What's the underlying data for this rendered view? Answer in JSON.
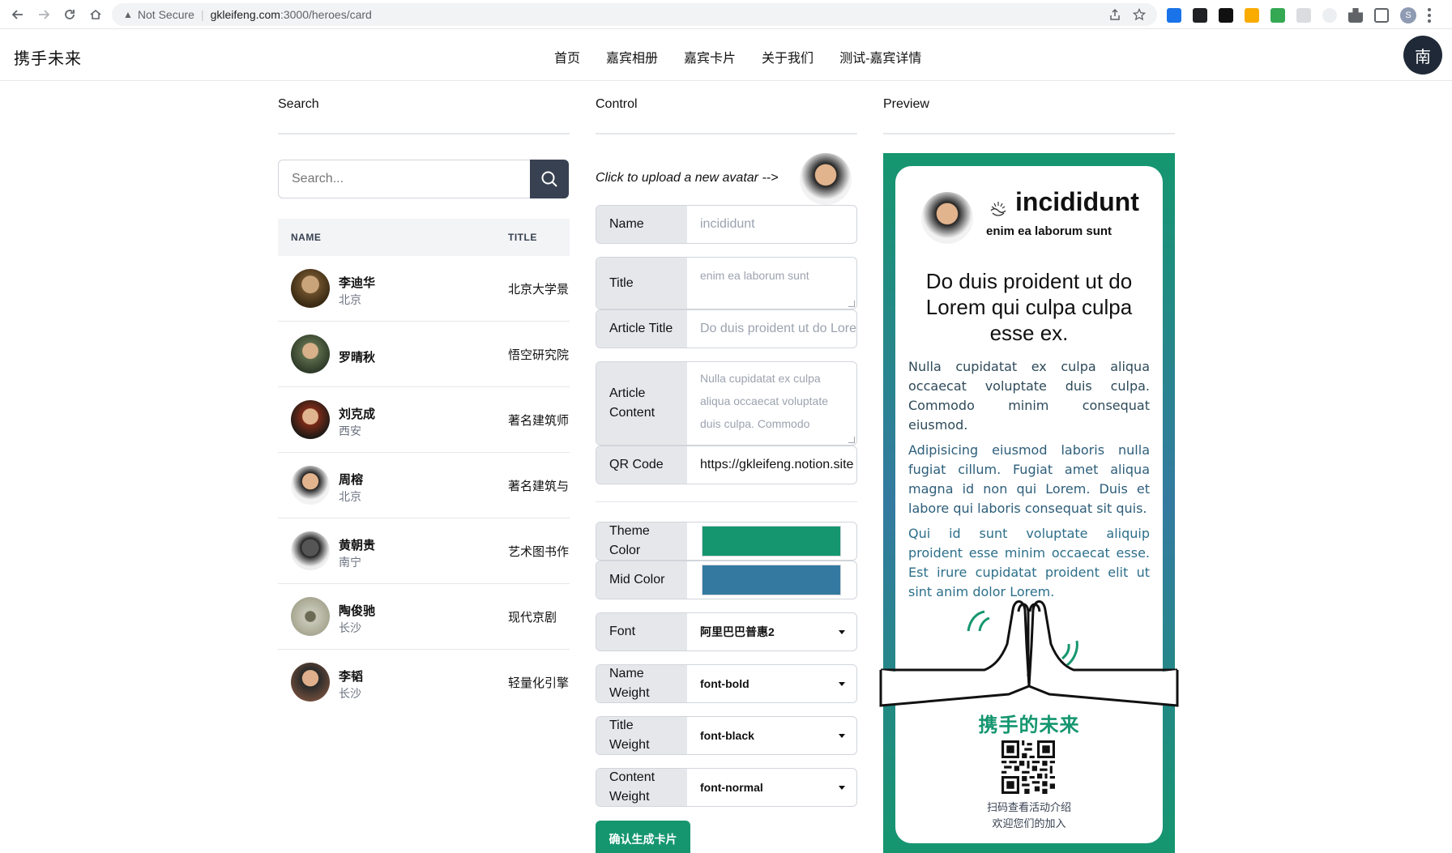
{
  "browser": {
    "security_label": "Not Secure",
    "url_host": "gkleifeng.com",
    "url_path": ":3000/heroes/card",
    "profile_initial": "S"
  },
  "site": {
    "brand": "携手未来",
    "nav": [
      "首页",
      "嘉宾相册",
      "嘉宾卡片",
      "关于我们",
      "测试-嘉宾详情"
    ],
    "user_avatar_char": "南"
  },
  "search": {
    "title": "Search",
    "placeholder": "Search...",
    "col_name": "NAME",
    "col_title": "TITLE",
    "rows": [
      {
        "name": "李迪华",
        "city": "北京",
        "title": "北京大学景"
      },
      {
        "name": "罗晴秋",
        "city": "",
        "title": "悟空研究院"
      },
      {
        "name": "刘克成",
        "city": "西安",
        "title": "著名建筑师"
      },
      {
        "name": "周榕",
        "city": "北京",
        "title": "著名建筑与"
      },
      {
        "name": "黄朝贵",
        "city": "南宁",
        "title": "艺术图书作"
      },
      {
        "name": "陶俊驰",
        "city": "长沙",
        "title": "现代京剧"
      },
      {
        "name": "李韬",
        "city": "长沙",
        "title": "轻量化引擎"
      }
    ]
  },
  "control": {
    "title": "Control",
    "upload_label": "Click to upload a new avatar -->",
    "fields": {
      "name_label": "Name",
      "name_value": "incididunt",
      "title_label": "Title",
      "title_value": "enim ea laborum sunt",
      "article_title_label": "Article Title",
      "article_title_value": "Do duis proident ut do Lorem qui culpa culpa esse ex.",
      "article_content_label": "Article Content",
      "article_content_value": "Nulla cupidatat ex culpa aliqua occaecat voluptate duis culpa. Commodo",
      "qr_label": "QR Code",
      "qr_value": "https://gkleifeng.notion.site",
      "theme_color_label": "Theme Color",
      "mid_color_label": "Mid Color",
      "font_label": "Font",
      "font_value": "阿里巴巴普惠2",
      "name_weight_label": "Name Weight",
      "name_weight_value": "font-bold",
      "title_weight_label": "Title Weight",
      "title_weight_value": "font-black",
      "content_weight_label": "Content Weight",
      "content_weight_value": "font-normal"
    },
    "theme_color": "#15966f",
    "mid_color": "#347aa0",
    "submit_label": "确认生成卡片"
  },
  "preview": {
    "title": "Preview",
    "name": "incididunt",
    "subtitle": "enim ea laborum sunt",
    "heading": "Do duis proident ut do Lorem qui culpa culpa esse ex.",
    "paragraphs": [
      "Nulla cupidatat ex culpa aliqua occaecat voluptate duis culpa. Commodo minim consequat eiusmod.",
      "Adipisicing eiusmod laboris nulla fugiat cillum. Fugiat amet aliqua magna id non qui Lorem. Duis et labore qui laboris consequat sit quis.",
      "Qui id sunt voluptate aliquip proident esse minim occaecat esse. Est irure cupidatat proident elit ut sint anim dolor Lorem."
    ],
    "slogan": "携手的未来",
    "qr_caption_1": "扫码查看活动介绍",
    "qr_caption_2": "欢迎您们的加入"
  }
}
